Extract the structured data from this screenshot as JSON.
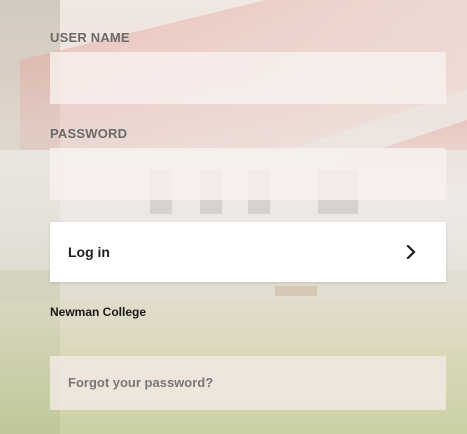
{
  "login_form": {
    "username": {
      "label": "USER NAME",
      "value": ""
    },
    "password": {
      "label": "PASSWORD",
      "value": ""
    },
    "login_button": {
      "label": "Log in",
      "icon": "chevron-right-icon"
    },
    "organization": "Newman College",
    "forgot_password": {
      "label": "Forgot your password?"
    }
  },
  "colors": {
    "label_text": "#6a6a6a",
    "input_background": "#f8f0ee",
    "button_background": "#ffffff",
    "button_text": "#1e1e1e",
    "secondary_text": "#777777"
  }
}
